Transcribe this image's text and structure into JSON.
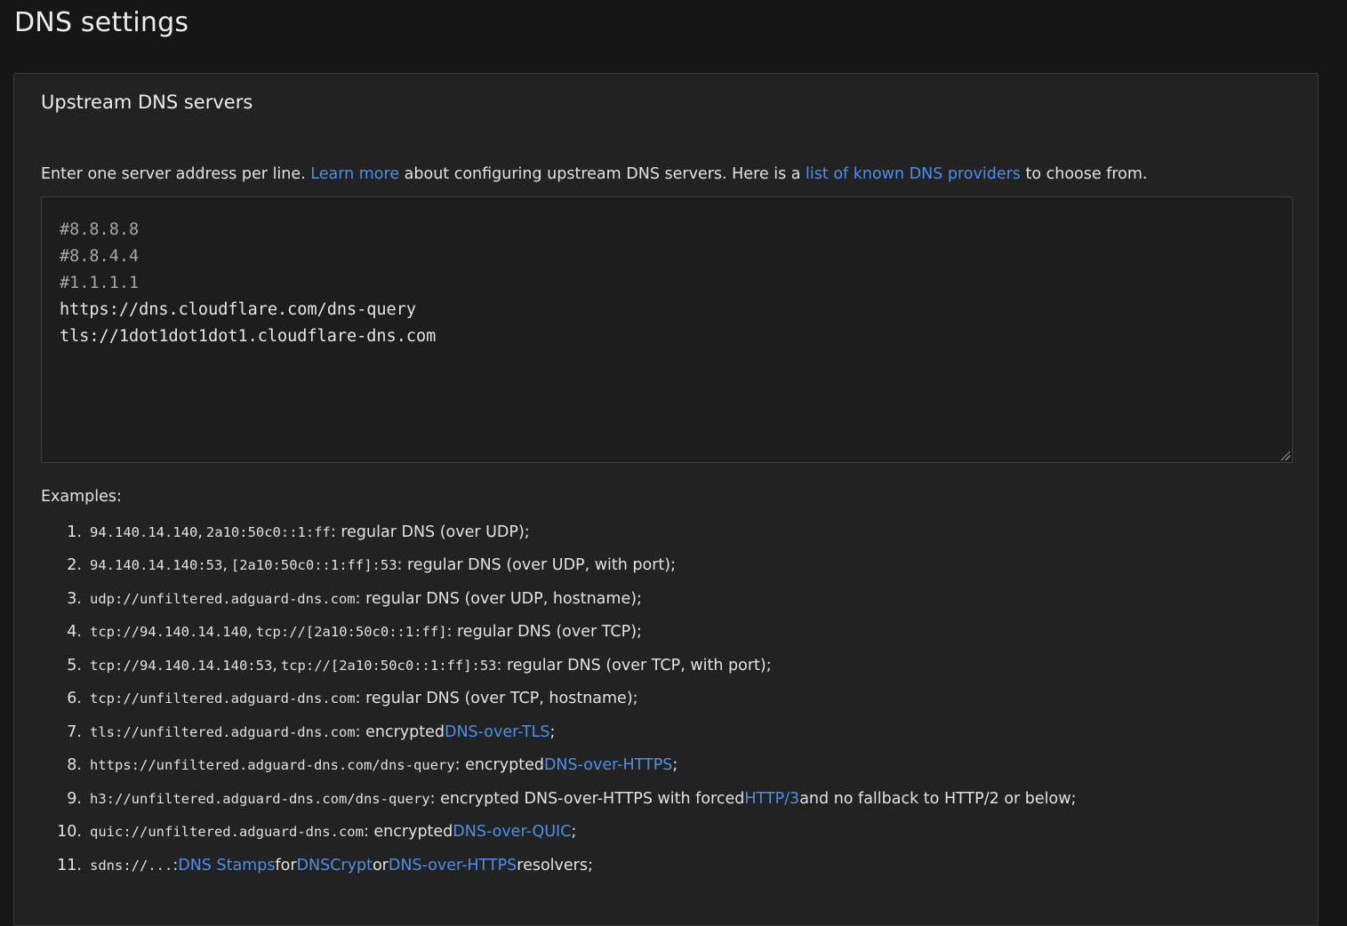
{
  "page": {
    "title": "DNS settings"
  },
  "upstream": {
    "title": "Upstream DNS servers",
    "intro": {
      "before": "Enter one server address per line. ",
      "learn_more": "Learn more",
      "middle": " about configuring upstream DNS servers. Here is a ",
      "providers_link": "list of known DNS providers",
      "after": " to choose from."
    },
    "servers": [
      "#8.8.8.8",
      "#8.8.4.4",
      "#1.1.1.1",
      "https://dns.cloudflare.com/dns-query",
      "tls://1dot1dot1dot1.cloudflare-dns.com"
    ],
    "examples_label": "Examples:",
    "examples": [
      {
        "num": "1.",
        "code1": "94.140.14.140",
        "code2": "2a10:50c0::1:ff",
        "text": ": regular DNS (over UDP);"
      },
      {
        "num": "2.",
        "code1": "94.140.14.140:53",
        "code2": "[2a10:50c0::1:ff]:53",
        "text": ": regular DNS (over UDP, with port);"
      },
      {
        "num": "3.",
        "code1": "udp://unfiltered.adguard-dns.com",
        "text": ": regular DNS (over UDP, hostname);"
      },
      {
        "num": "4.",
        "code1": "tcp://94.140.14.140",
        "code2": "tcp://[2a10:50c0::1:ff]",
        "text": ": regular DNS (over TCP);"
      },
      {
        "num": "5.",
        "code1": "tcp://94.140.14.140:53",
        "code2": "tcp://[2a10:50c0::1:ff]:53",
        "text": ": regular DNS (over TCP, with port);"
      },
      {
        "num": "6.",
        "code1": "tcp://unfiltered.adguard-dns.com",
        "text": ": regular DNS (over TCP, hostname);"
      },
      {
        "num": "7.",
        "code1": "tls://unfiltered.adguard-dns.com",
        "text": ": encrypted ",
        "link": "DNS-over-TLS",
        "tail": ";"
      },
      {
        "num": "8.",
        "code1": "https://unfiltered.adguard-dns.com/dns-query",
        "text": ": encrypted ",
        "link": "DNS-over-HTTPS",
        "tail": ";"
      },
      {
        "num": "9.",
        "code1": "h3://unfiltered.adguard-dns.com/dns-query",
        "text": ": encrypted DNS-over-HTTPS with forced ",
        "link": "HTTP/3",
        "tail": " and no fallback to HTTP/2 or below;"
      },
      {
        "num": "10.",
        "code1": "quic://unfiltered.adguard-dns.com",
        "text": ": encrypted ",
        "link": "DNS-over-QUIC",
        "tail": ";"
      },
      {
        "num": "11.",
        "code1": "sdns://...",
        "text": ": ",
        "link": "DNS Stamps",
        "mid": " for ",
        "link2": "DNSCrypt",
        "mid2": " or ",
        "link3": "DNS-over-HTTPS",
        "tail": " resolvers;"
      }
    ]
  },
  "colors": {
    "background": "#161616",
    "card": "#222222",
    "link": "#4d8fe8",
    "text": "#e2e2e2"
  }
}
